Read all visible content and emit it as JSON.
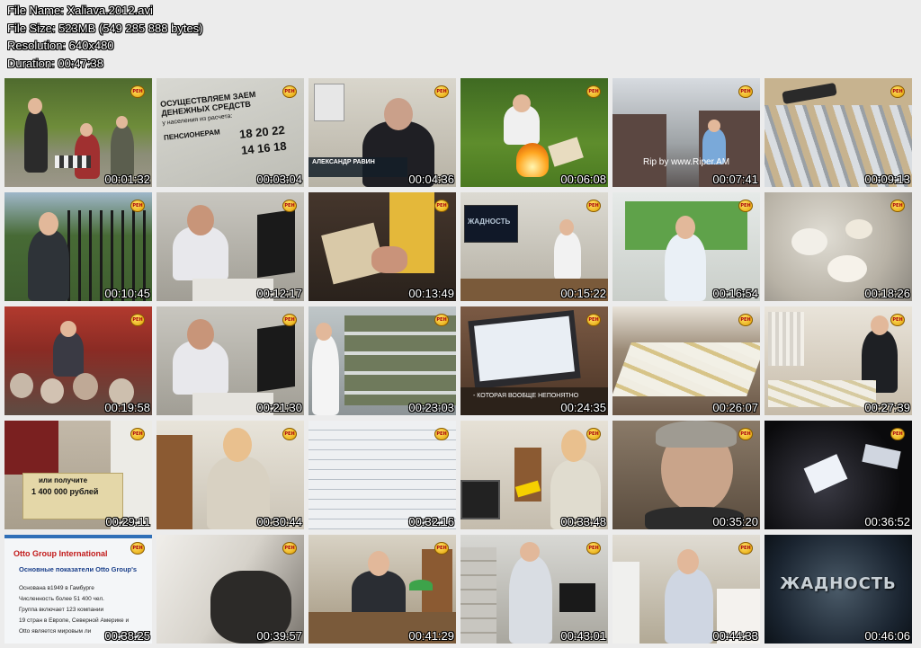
{
  "file_info": {
    "file_name": "File Name: Xaliava.2012.avi",
    "file_size": "File Size: 523MB (549 285 888 bytes)",
    "resolution": "Resolution: 640x480",
    "duration": "Duration: 00:47:38"
  },
  "thumbnails": [
    {
      "time": "00:01:32"
    },
    {
      "time": "00:03:04",
      "lines": [
        "ОСУЩЕСТВЛЯЕМ ЗАЕМ",
        "ДЕНЕЖНЫХ СРЕДСТВ",
        "у населения из расчета:",
        "ПЕНСИОНЕРАМ",
        "18 20 22",
        "14 16 18"
      ]
    },
    {
      "time": "00:04:36",
      "caption": "АЛЕКСАНДР РАВИН"
    },
    {
      "time": "00:06:08"
    },
    {
      "time": "00:07:41",
      "caption": "Rip by www.Riper.AM"
    },
    {
      "time": "00:09:13"
    },
    {
      "time": "00:10:45"
    },
    {
      "time": "00:12:17"
    },
    {
      "time": "00:13:49"
    },
    {
      "time": "00:15:22",
      "caption": "ЖАДНОСТЬ"
    },
    {
      "time": "00:16:54"
    },
    {
      "time": "00:18:26"
    },
    {
      "time": "00:19:58"
    },
    {
      "time": "00:21:30"
    },
    {
      "time": "00:23:03"
    },
    {
      "time": "00:24:35",
      "caption": "- КОТОРАЯ ВООБЩЕ НЕПОНЯТНО"
    },
    {
      "time": "00:26:07"
    },
    {
      "time": "00:27:39"
    },
    {
      "time": "00:29:11",
      "lines": [
        "или получите",
        "1 400 000 рублей"
      ]
    },
    {
      "time": "00:30:44"
    },
    {
      "time": "00:32:16"
    },
    {
      "time": "00:33:48"
    },
    {
      "time": "00:35:20"
    },
    {
      "time": "00:36:52"
    },
    {
      "time": "00:38:25",
      "lines": [
        "Otto Group International",
        "Основные показатели Otto Group's",
        "Основана в1949 в Гамбурге",
        "Численность более 51 400 чел.",
        "Группа включает 123 компании",
        "19 стран в Европе, Северной Америке и",
        "Otto является мировым ли"
      ]
    },
    {
      "time": "00:39:57"
    },
    {
      "time": "00:41:29"
    },
    {
      "time": "00:43:01"
    },
    {
      "time": "00:44:33"
    },
    {
      "time": "00:46:06",
      "caption": "ЖАДНОСТЬ"
    }
  ],
  "logo_text": "РЕН"
}
